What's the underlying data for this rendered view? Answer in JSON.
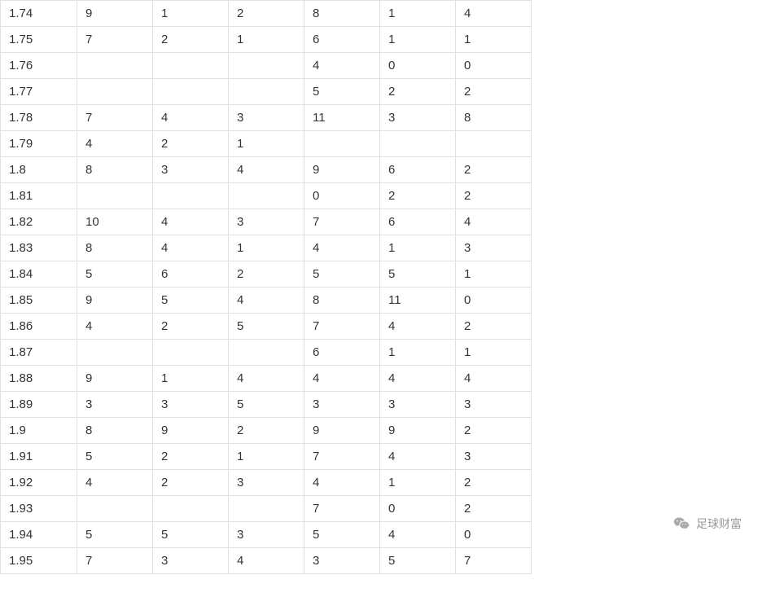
{
  "table": {
    "rows": [
      [
        "1.74",
        "9",
        "1",
        "2",
        "8",
        "1",
        "4"
      ],
      [
        "1.75",
        "7",
        "2",
        "1",
        "6",
        "1",
        "1"
      ],
      [
        "1.76",
        "",
        "",
        "",
        "4",
        "0",
        "0"
      ],
      [
        "1.77",
        "",
        "",
        "",
        "5",
        "2",
        "2"
      ],
      [
        "1.78",
        "7",
        "4",
        "3",
        "11",
        "3",
        "8"
      ],
      [
        "1.79",
        "4",
        "2",
        "1",
        "",
        "",
        ""
      ],
      [
        "1.8",
        "8",
        "3",
        "4",
        "9",
        "6",
        "2"
      ],
      [
        "1.81",
        "",
        "",
        "",
        "0",
        "2",
        "2"
      ],
      [
        "1.82",
        "10",
        "4",
        "3",
        "7",
        "6",
        "4"
      ],
      [
        "1.83",
        "8",
        "4",
        "1",
        "4",
        "1",
        "3"
      ],
      [
        "1.84",
        "5",
        "6",
        "2",
        "5",
        "5",
        "1"
      ],
      [
        "1.85",
        "9",
        "5",
        "4",
        "8",
        "11",
        "0"
      ],
      [
        "1.86",
        "4",
        "2",
        "5",
        "7",
        "4",
        "2"
      ],
      [
        "1.87",
        "",
        "",
        "",
        "6",
        "1",
        "1"
      ],
      [
        "1.88",
        "9",
        "1",
        "4",
        "4",
        "4",
        "4"
      ],
      [
        "1.89",
        "3",
        "3",
        "5",
        "3",
        "3",
        "3"
      ],
      [
        "1.9",
        "8",
        "9",
        "2",
        "9",
        "9",
        "2"
      ],
      [
        "1.91",
        "5",
        "2",
        "1",
        "7",
        "4",
        "3"
      ],
      [
        "1.92",
        "4",
        "2",
        "3",
        "4",
        "1",
        "2"
      ],
      [
        "1.93",
        "",
        "",
        "",
        "7",
        "0",
        "2"
      ],
      [
        "1.94",
        "5",
        "5",
        "3",
        "5",
        "4",
        "0"
      ],
      [
        "1.95",
        "7",
        "3",
        "4",
        "3",
        "5",
        "7"
      ]
    ]
  },
  "watermark": {
    "label": "足球财富"
  }
}
